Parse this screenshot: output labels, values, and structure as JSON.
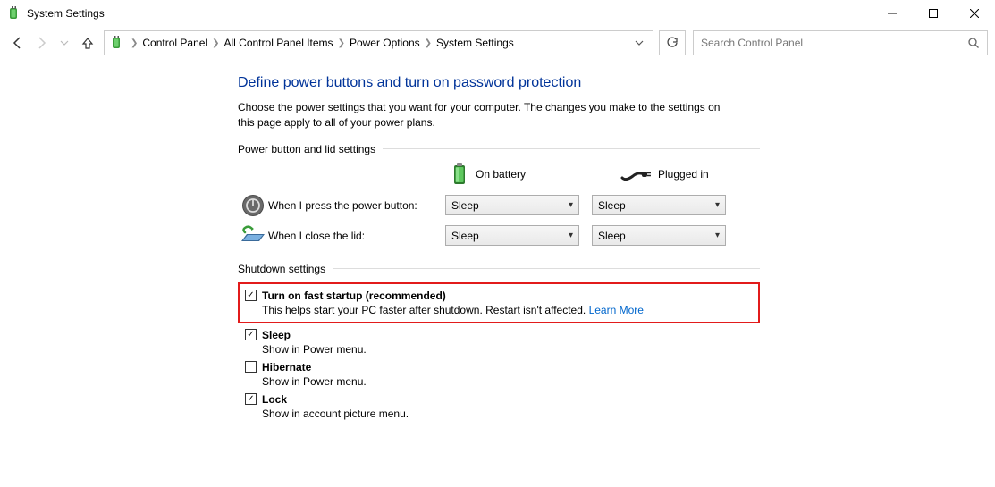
{
  "window": {
    "title": "System Settings"
  },
  "breadcrumb": {
    "items": [
      "Control Panel",
      "All Control Panel Items",
      "Power Options",
      "System Settings"
    ]
  },
  "search": {
    "placeholder": "Search Control Panel"
  },
  "page": {
    "heading": "Define power buttons and turn on password protection",
    "description": "Choose the power settings that you want for your computer. The changes you make to the settings on this page apply to all of your power plans.",
    "section1_title": "Power button and lid settings",
    "col_battery": "On battery",
    "col_plugged": "Plugged in",
    "rows": [
      {
        "label": "When I press the power button:",
        "battery": "Sleep",
        "plugged": "Sleep"
      },
      {
        "label": "When I close the lid:",
        "battery": "Sleep",
        "plugged": "Sleep"
      }
    ],
    "section2_title": "Shutdown settings",
    "options": [
      {
        "title": "Turn on fast startup (recommended)",
        "sub": "This helps start your PC faster after shutdown. Restart isn't affected. ",
        "learn": "Learn More",
        "checked": true,
        "highlight": true
      },
      {
        "title": "Sleep",
        "sub": "Show in Power menu.",
        "checked": true
      },
      {
        "title": "Hibernate",
        "sub": "Show in Power menu.",
        "checked": false
      },
      {
        "title": "Lock",
        "sub": "Show in account picture menu.",
        "checked": true
      }
    ]
  }
}
